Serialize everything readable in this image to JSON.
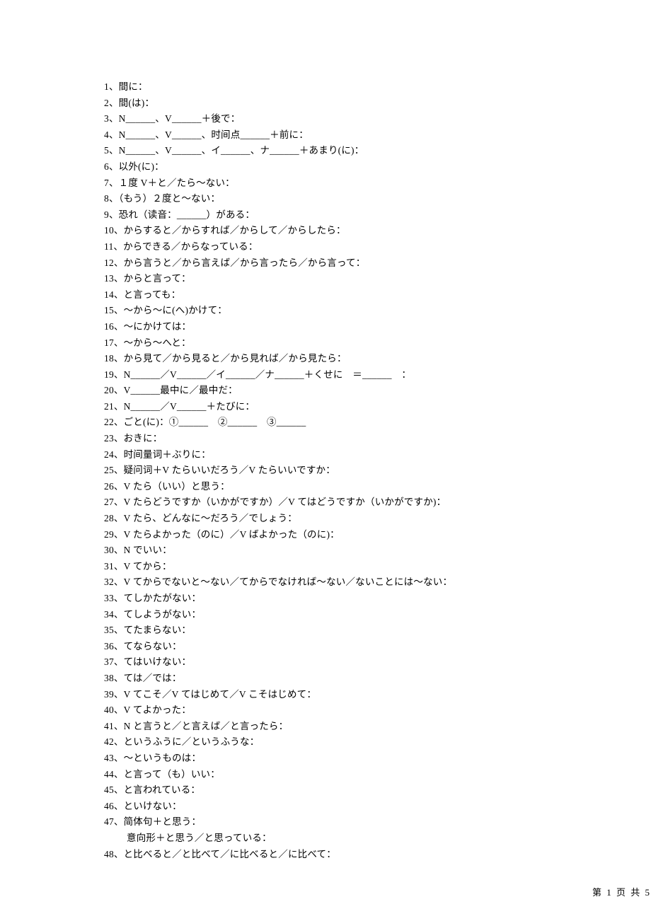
{
  "lines": [
    "1、間に：",
    "2、間(は)：",
    "3、N______、V______＋後で：",
    "4、N______、V______、时间点______＋前に：",
    "5、N______、V______、イ______、ナ______＋あまり(に)：",
    "6、以外(に)：",
    "7、１度 V＋と／たら～ない：",
    "8、（もう）２度と～ない：",
    "9、恐れ（读音：______）がある：",
    "10、からすると／からすれば／からして／からしたら：",
    "11、からできる／からなっている：",
    "12、から言うと／から言えば／から言ったら／から言って：",
    "13、からと言って：",
    "14、と言っても：",
    "15、～から～に(へ)かけて：",
    "16、～にかけては：",
    "17、～から～へと：",
    "18、から見て／から見ると／から見れば／から見たら：",
    "19、N______／V______／イ______／ナ______＋くせに　＝______　：",
    "20、V______最中に／最中だ：",
    "21、N______／V______＋たびに：",
    "22、ごと(に)：①______　②______　③______",
    "23、おきに：",
    "24、时间量词＋ぶりに：",
    "25、疑问词＋V たらいいだろう／V たらいいですか：",
    "26、V たら（いい）と思う：",
    "27、V たらどうですか（いかがですか）／V てはどうですか（いかがですか)：",
    "28、V たら、どんなに～だろう／でしょう：",
    "29、V たらよかった（のに）／V ばよかった（のに)：",
    "30、N でいい：",
    "31、V てから：",
    "32、V てからでないと～ない／てからでなければ～ない／ないことには～ない：",
    "33、てしかたがない：",
    "34、てしようがない：",
    "35、てたまらない：",
    "36、てならない：",
    "37、てはいけない：",
    "38、ては／では：",
    "39、V てこそ／V てはじめて／V こそはじめて：",
    "40、V てよかった：",
    "41、N と言うと／と言えば／と言ったら：",
    "42、というふうに／というふうな：",
    "43、～というものは：",
    "44、と言って（も）いい：",
    "45、と言われている：",
    "46、といけない：",
    "47、简体句＋と思う：",
    "意向形＋と思う／と思っている：",
    "48、と比べると／と比べて／に比べると／に比べて："
  ],
  "indentedIndexes": [
    47
  ],
  "footer": "第 1 页 共 5"
}
